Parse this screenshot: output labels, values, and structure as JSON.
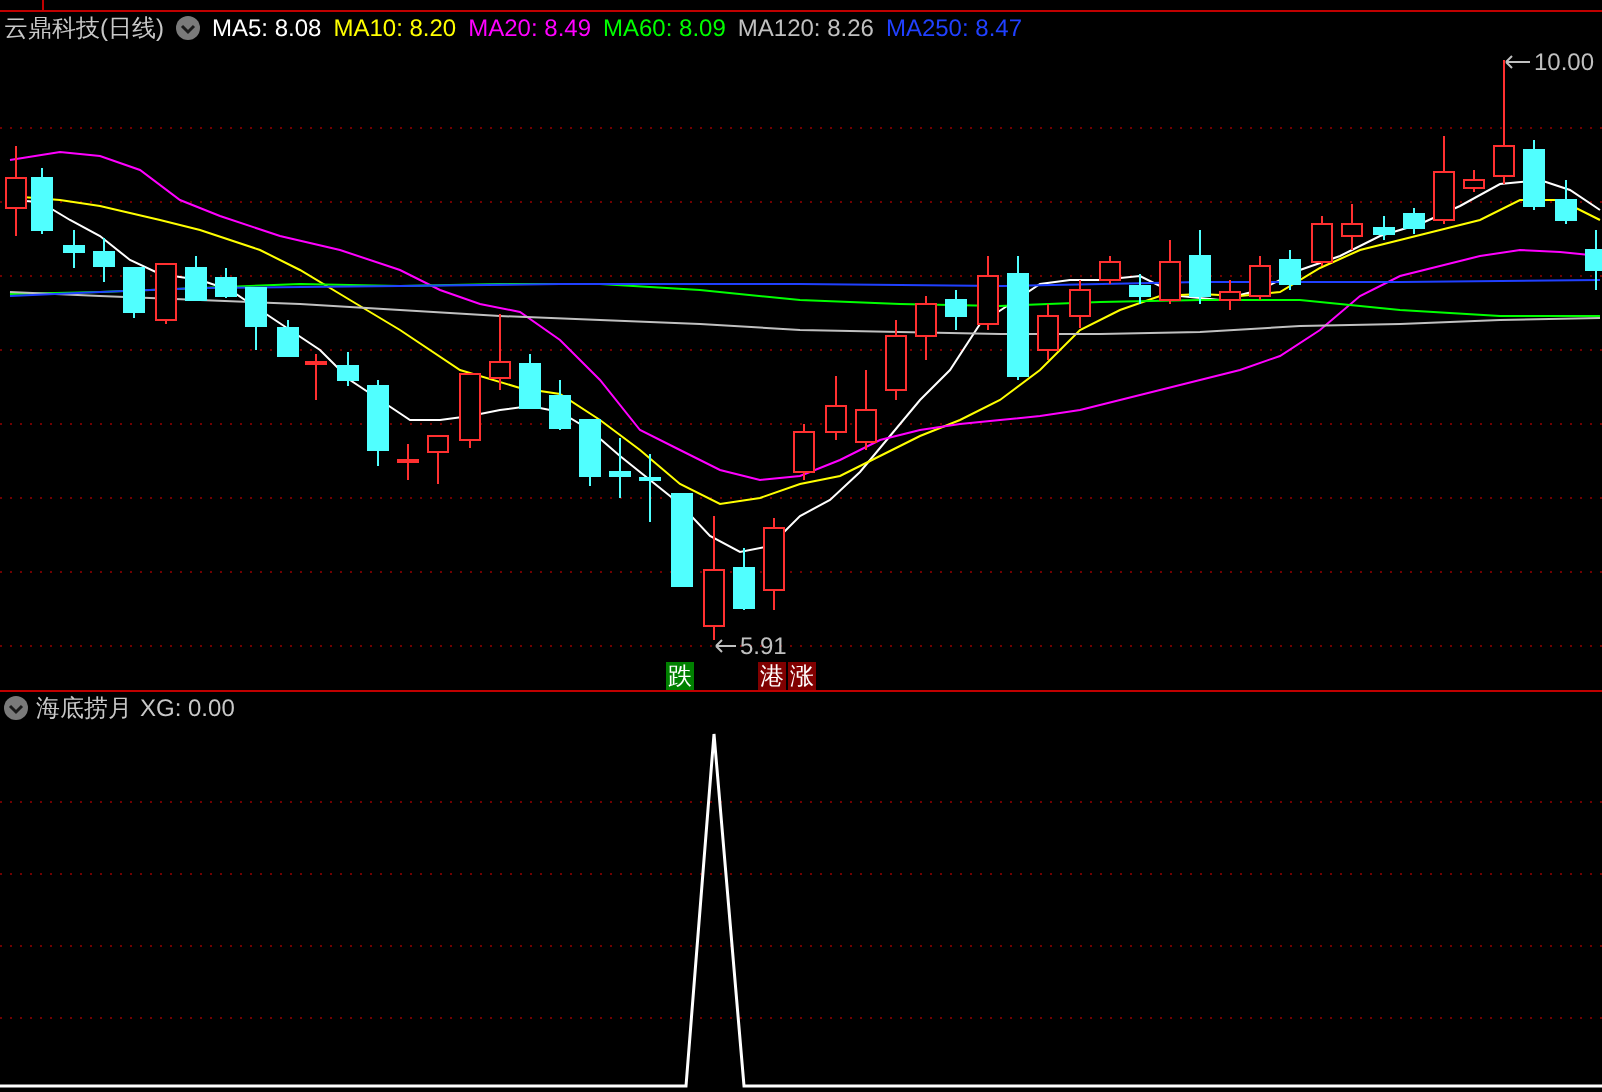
{
  "chart_header": {
    "title": "云鼎科技(日线)",
    "moving_averages": [
      {
        "label": "MA5:",
        "value": "8.08",
        "color": "#ffffff"
      },
      {
        "label": "MA10:",
        "value": "8.20",
        "color": "#ffff00"
      },
      {
        "label": "MA20:",
        "value": "8.49",
        "color": "#ff00ff"
      },
      {
        "label": "MA60:",
        "value": "8.09",
        "color": "#00ff00"
      },
      {
        "label": "MA120:",
        "value": "8.26",
        "color": "#c0c0c0"
      },
      {
        "label": "MA250:",
        "value": "8.47",
        "color": "#2040ff"
      }
    ]
  },
  "price_markers": {
    "high": "10.00",
    "low": "5.91"
  },
  "signal_tags": [
    {
      "text": "跌",
      "color": "#008000"
    },
    {
      "text": "港",
      "color": "#800000"
    },
    {
      "text": "涨",
      "color": "#800000"
    }
  ],
  "indicator": {
    "name": "海底捞月",
    "reading": "XG: 0.00"
  }
}
